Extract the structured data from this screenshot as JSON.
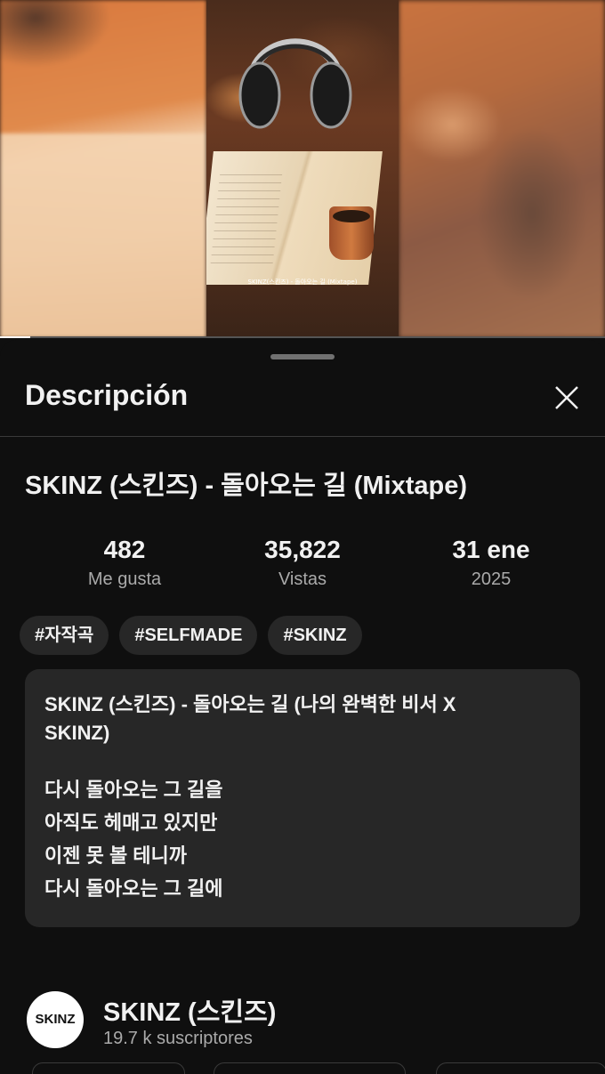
{
  "video": {
    "frame_caption": "SKINZ(스킨즈) - 돌아오는 길 (Mixtape)",
    "progress_fraction": 0.05
  },
  "sheet": {
    "title": "Descripción",
    "close_icon": "close-icon"
  },
  "video_info": {
    "title": "SKINZ (스킨즈) - 돌아오는 길 (Mixtape)",
    "stats": [
      {
        "value": "482",
        "label": "Me gusta"
      },
      {
        "value": "35,822",
        "label": "Vistas"
      },
      {
        "value": "31 ene",
        "label": "2025"
      }
    ],
    "tags": [
      "#자작곡",
      "#SELFMADE",
      "#SKINZ"
    ]
  },
  "description": {
    "lines": [
      "SKINZ (스킨즈) - 돌아오는 길 (나의 완벽한 비서 X",
      "SKINZ)",
      "",
      "다시 돌아오는 그 길을",
      "아직도 헤매고 있지만",
      "이젠 못 볼 테니까",
      "다시 돌아오는 그 길에"
    ]
  },
  "channel": {
    "avatar_text": "SKINZ",
    "name": "SKINZ (스킨즈)",
    "subscribers": "19.7 k suscriptores"
  },
  "colors": {
    "background": "#0f0f0f",
    "surface": "#272727",
    "text_primary": "#f1f1f1",
    "text_secondary": "#aaaaaa"
  }
}
